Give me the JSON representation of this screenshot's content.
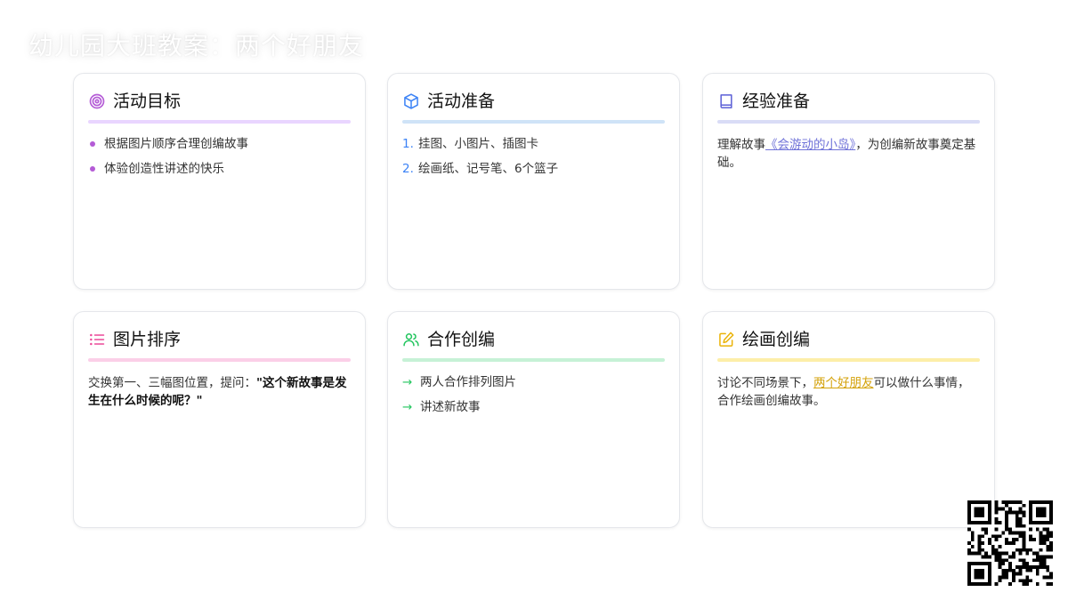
{
  "page": {
    "title": "幼儿园大班教案：两个好朋友"
  },
  "cards": {
    "goals": {
      "title": "活动目标",
      "icon": "target-icon",
      "accent": "#c084e8",
      "rule": "#e9d5ff",
      "items": [
        "根据图片顺序合理创编故事",
        "体验创造性讲述的快乐"
      ]
    },
    "prep": {
      "title": "活动准备",
      "icon": "package-icon",
      "accent": "#3b82f6",
      "rule": "#cfe3f7",
      "items": [
        "挂图、小图片、插图卡",
        "绘画纸、记号笔、6个篮子"
      ],
      "numbers": [
        "1.",
        "2."
      ]
    },
    "experience": {
      "title": "经验准备",
      "icon": "book-icon",
      "accent": "#6366f1",
      "rule": "#d9dcf6",
      "text_before": "理解故事",
      "link": "《会游动的小岛》",
      "text_after": "，为创编新故事奠定基础。"
    },
    "order": {
      "title": "图片排序",
      "icon": "list-icon",
      "accent": "#ec4899",
      "rule": "#fbcfe8",
      "text_before": "交换第一、三幅图位置，提问：",
      "quote_open": "\"",
      "bold": "这个新故事是发生在什么时候的呢？",
      "quote_close": "\""
    },
    "cooperate": {
      "title": "合作创编",
      "icon": "users-icon",
      "accent": "#22c55e",
      "rule": "#c6f1d6",
      "items": [
        "两人合作排列图片",
        "讲述新故事"
      ],
      "arrow": "→"
    },
    "draw": {
      "title": "绘画创编",
      "icon": "edit-icon",
      "accent": "#eab308",
      "rule": "#fdeea8",
      "text_before": "讨论不同场景下，",
      "link": "两个好朋友",
      "text_after": "可以做什么事情，合作绘画创编故事。"
    }
  },
  "qr": {
    "icon": "qr-code-icon"
  }
}
